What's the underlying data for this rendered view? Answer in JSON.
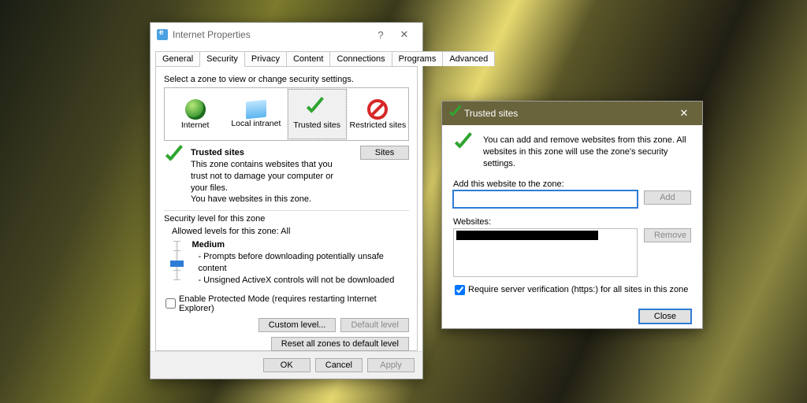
{
  "prop": {
    "title": "Internet Properties",
    "tabs": [
      "General",
      "Security",
      "Privacy",
      "Content",
      "Connections",
      "Programs",
      "Advanced"
    ],
    "active_tab": 1,
    "zone_prompt": "Select a zone to view or change security settings.",
    "zones": [
      "Internet",
      "Local intranet",
      "Trusted sites",
      "Restricted sites"
    ],
    "selected_zone": 2,
    "zone_title": "Trusted sites",
    "zone_desc1": "This zone contains websites that you trust not to damage your computer or your files.",
    "zone_desc2": "You have websites in this zone.",
    "sites_btn": "Sites",
    "sec_level_heading": "Security level for this zone",
    "allowed_levels": "Allowed levels for this zone: All",
    "level_name": "Medium",
    "level_b1": "- Prompts before downloading potentially unsafe content",
    "level_b2": "- Unsigned ActiveX controls will not be downloaded",
    "protected_mode": "Enable Protected Mode (requires restarting Internet Explorer)",
    "custom_level_btn": "Custom level...",
    "default_level_btn": "Default level",
    "reset_btn": "Reset all zones to default level",
    "ok": "OK",
    "cancel": "Cancel",
    "apply": "Apply"
  },
  "ts": {
    "title": "Trusted sites",
    "msg": "You can add and remove websites from this zone. All websites in this zone will use the zone's security settings.",
    "add_label": "Add this website to the zone:",
    "add_btn": "Add",
    "websites_label": "Websites:",
    "remove_btn": "Remove",
    "require_https": "Require server verification (https:) for all sites in this zone",
    "close": "Close",
    "input_value": ""
  }
}
